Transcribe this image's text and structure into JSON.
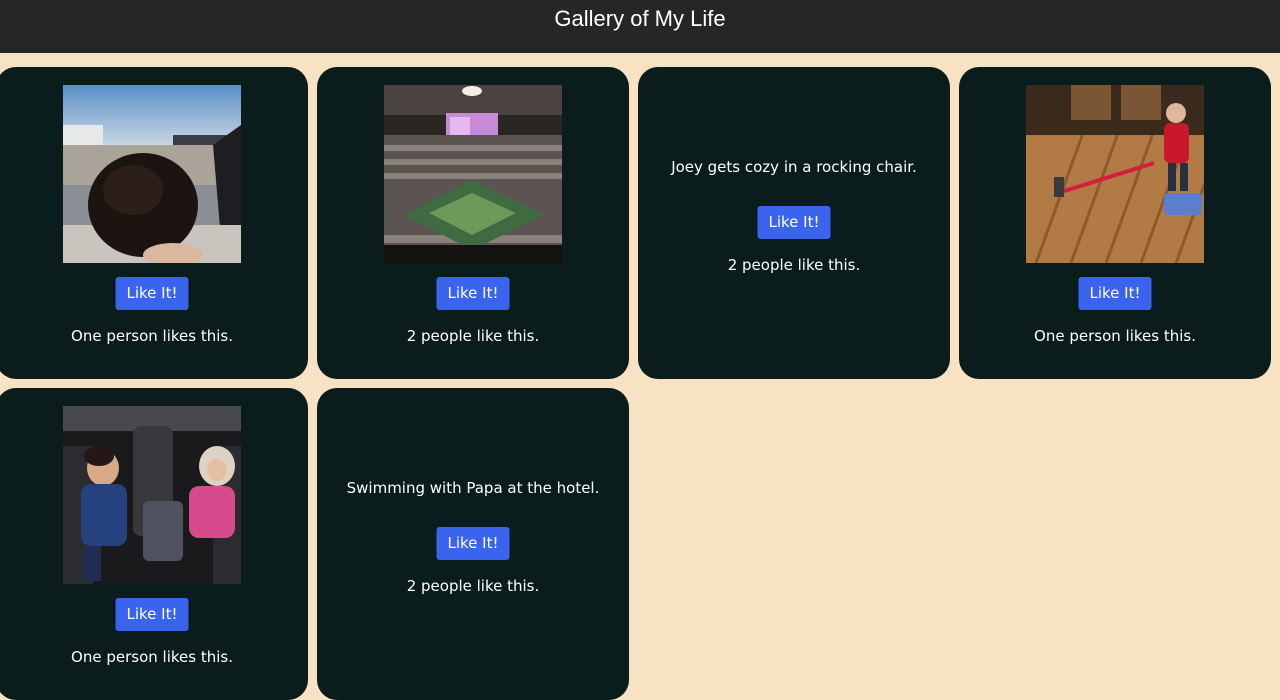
{
  "header": {
    "title": "Gallery of My Life"
  },
  "colors": {
    "background": "#f8e2c4",
    "card": "#0b1c1c",
    "button": "#3a63ee",
    "topbar": "#262626"
  },
  "cards": [
    {
      "type": "image",
      "photo_icon": "child-in-car-photo",
      "button_label": "Like It!",
      "likes_text": "One person likes this."
    },
    {
      "type": "image",
      "photo_icon": "basketball-arena-photo",
      "button_label": "Like It!",
      "likes_text": "2 people like this."
    },
    {
      "type": "text",
      "caption": "Joey gets cozy in a rocking chair.",
      "button_label": "Like It!",
      "likes_text": "2 people like this."
    },
    {
      "type": "image",
      "photo_icon": "toddler-vacuuming-photo",
      "button_label": "Like It!",
      "likes_text": "One person likes this."
    },
    {
      "type": "image",
      "photo_icon": "kids-sleeping-in-car-photo",
      "button_label": "Like It!",
      "likes_text": "One person likes this."
    },
    {
      "type": "text",
      "caption": "Swimming with Papa at the hotel.",
      "button_label": "Like It!",
      "likes_text": "2 people like this."
    }
  ]
}
